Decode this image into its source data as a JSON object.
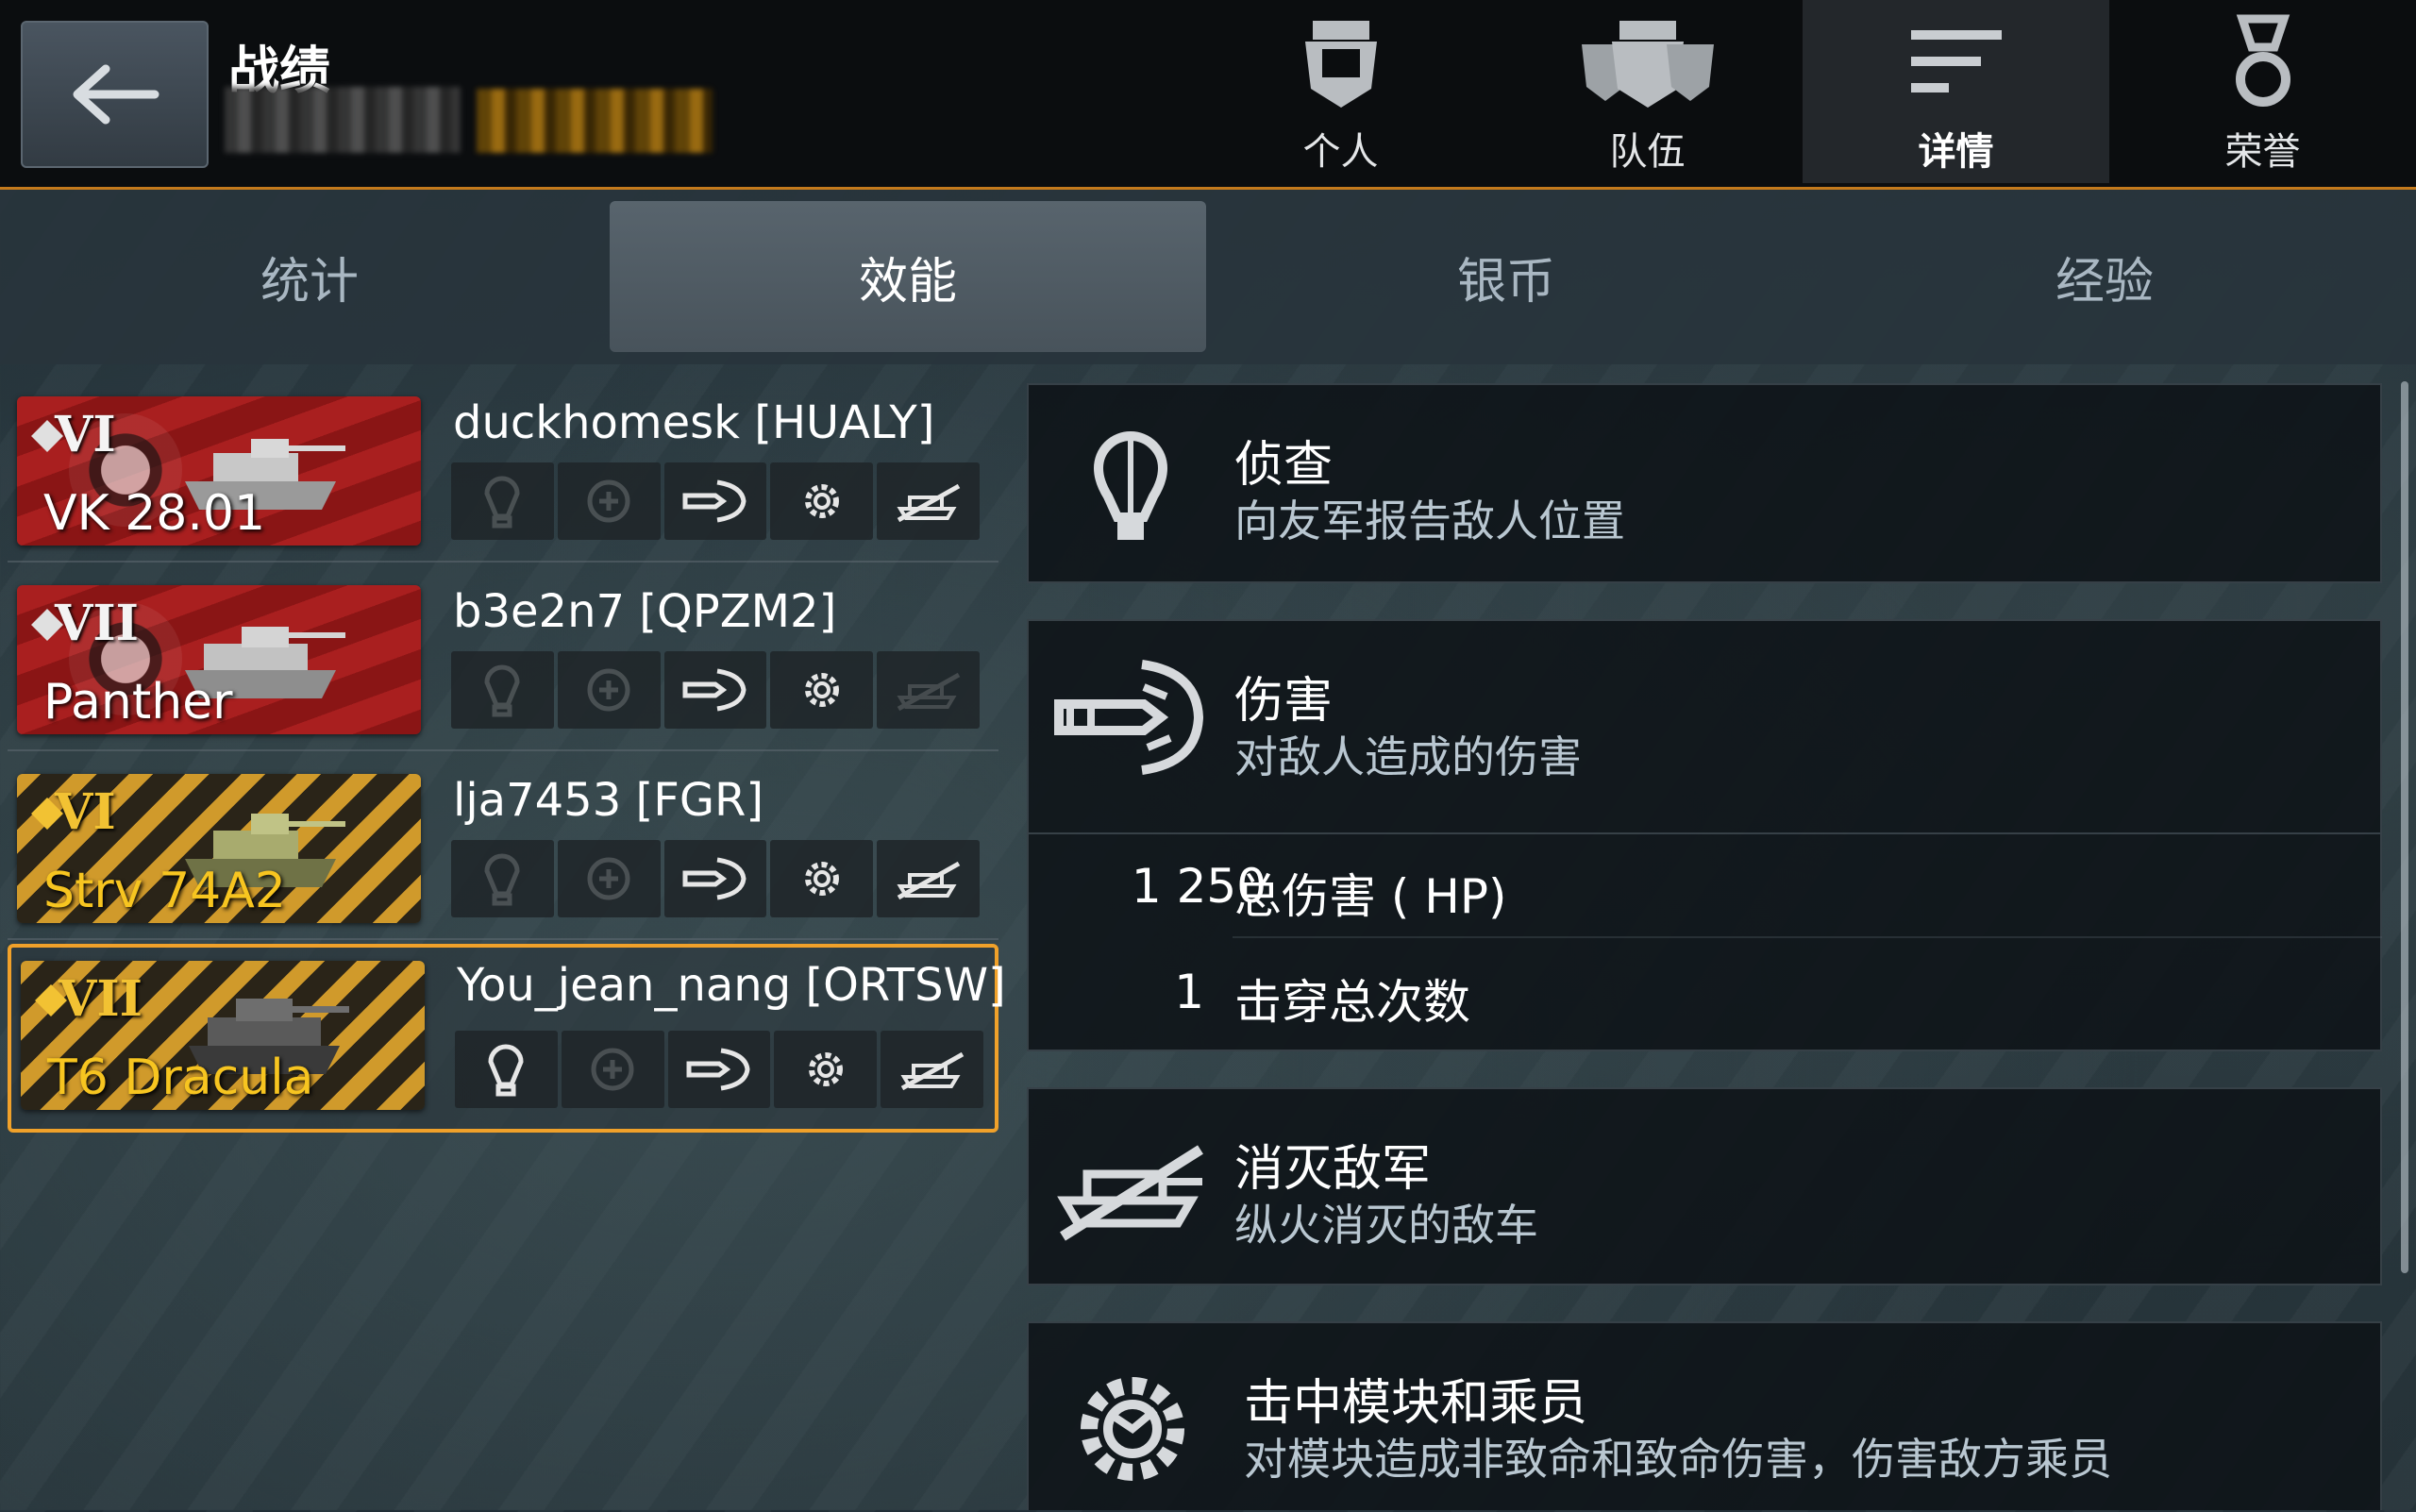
{
  "header": {
    "back_label": "←",
    "title": "战绩"
  },
  "nav_tabs": [
    {
      "label": "个人",
      "icon": "soldier-icon"
    },
    {
      "label": "队伍",
      "icon": "team-icon"
    },
    {
      "label": "详情",
      "icon": "details-icon",
      "active": true
    },
    {
      "label": "荣誉",
      "icon": "medal-icon"
    }
  ],
  "sub_tabs": [
    {
      "label": "统计"
    },
    {
      "label": "效能",
      "active": true
    },
    {
      "label": "银币"
    },
    {
      "label": "经验"
    }
  ],
  "vehicles": [
    {
      "tier": "VI",
      "name": "VK 28.01",
      "player": "duckhomesk [HUALY]",
      "nation": "germany",
      "premium": false,
      "medals": {
        "spotting": false,
        "assist": false,
        "damage": true,
        "critical": true,
        "kill": true
      }
    },
    {
      "tier": "VII",
      "name": "Panther",
      "player": "b3e2n7 [QPZM2]",
      "nation": "germany",
      "premium": false,
      "medals": {
        "spotting": false,
        "assist": false,
        "damage": true,
        "critical": true,
        "kill": false
      }
    },
    {
      "tier": "VI",
      "name": "Strv 74A2",
      "player": "lja7453 [FGR]",
      "nation": "sweden",
      "premium": true,
      "medals": {
        "spotting": false,
        "assist": false,
        "damage": true,
        "critical": true,
        "kill": true
      }
    },
    {
      "tier": "VII",
      "name": "T6 Dracula",
      "player": "You_jean_nang [ORTSW]",
      "nation": "usa",
      "premium": true,
      "selected": true,
      "medals": {
        "spotting": true,
        "assist": false,
        "damage": true,
        "critical": true,
        "kill": true
      }
    }
  ],
  "details": {
    "spotting": {
      "title": "侦查",
      "subtitle": "向友军报告敌人位置"
    },
    "damage": {
      "title": "伤害",
      "subtitle": "对敌人造成的伤害",
      "stats": [
        {
          "value": "1 250",
          "label": "总伤害 ( HP)"
        },
        {
          "value": "1",
          "label": "击穿总次数"
        }
      ]
    },
    "kills": {
      "title": "消灭敌军",
      "subtitle": "纵火消灭的敌车"
    },
    "critical": {
      "title": "击中模块和乘员",
      "subtitle": "对模块造成非致命和致命伤害，伤害敌方乘员"
    }
  },
  "colors": {
    "accent": "#c47a1c",
    "highlight": "#f0a12a",
    "gold_text": "#f7c520"
  }
}
